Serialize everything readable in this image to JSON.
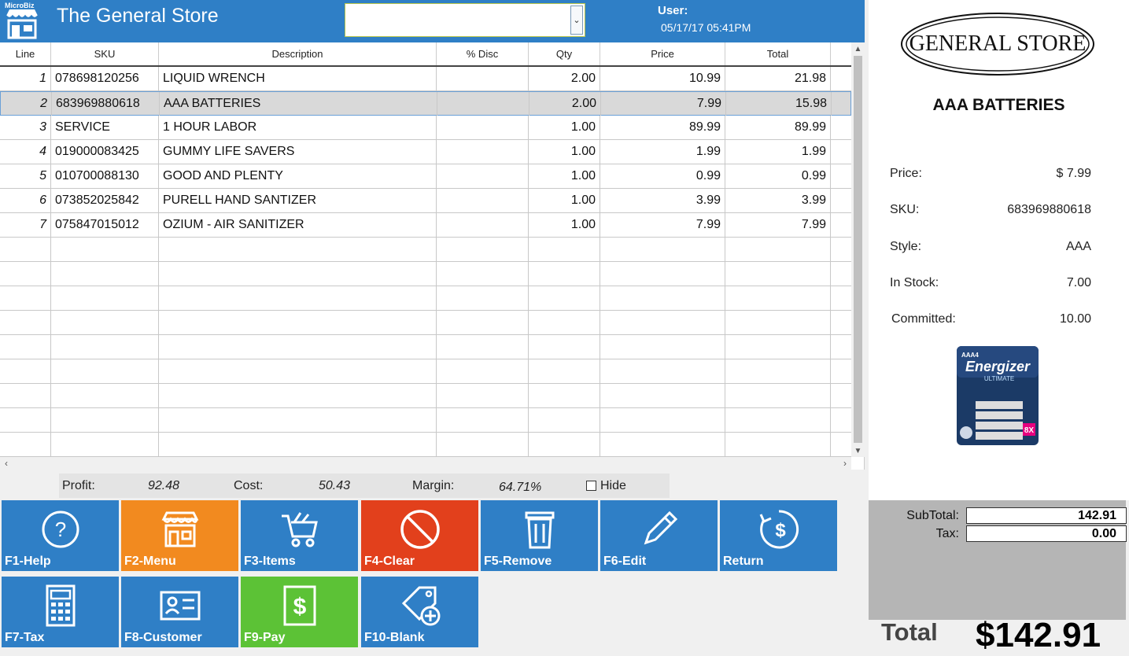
{
  "header": {
    "brand_tag": "MicroBiz",
    "store_title": "The General Store",
    "user_select_value": "",
    "user_label": "User:",
    "datetime": "05/17/17 05:41PM"
  },
  "grid": {
    "columns": [
      "Line",
      "SKU",
      "Description",
      "% Disc",
      "Qty",
      "Price",
      "Total"
    ],
    "rows": [
      {
        "line": "1",
        "sku": "078698120256",
        "description": "LIQUID WRENCH",
        "disc": "",
        "qty": "2.00",
        "price": "10.99",
        "total": "21.98"
      },
      {
        "line": "2",
        "sku": "683969880618",
        "description": "AAA BATTERIES",
        "disc": "",
        "qty": "2.00",
        "price": "7.99",
        "total": "15.98"
      },
      {
        "line": "3",
        "sku": "SERVICE",
        "description": "1 HOUR LABOR",
        "disc": "",
        "qty": "1.00",
        "price": "89.99",
        "total": "89.99"
      },
      {
        "line": "4",
        "sku": "019000083425",
        "description": "GUMMY LIFE SAVERS",
        "disc": "",
        "qty": "1.00",
        "price": "1.99",
        "total": "1.99"
      },
      {
        "line": "5",
        "sku": "010700088130",
        "description": "GOOD AND PLENTY",
        "disc": "",
        "qty": "1.00",
        "price": "0.99",
        "total": "0.99"
      },
      {
        "line": "6",
        "sku": "073852025842",
        "description": "PURELL HAND SANTIZER",
        "disc": "",
        "qty": "1.00",
        "price": "3.99",
        "total": "3.99"
      },
      {
        "line": "7",
        "sku": "075847015012",
        "description": "OZIUM - AIR SANITIZER",
        "disc": "",
        "qty": "1.00",
        "price": "7.99",
        "total": "7.99"
      }
    ],
    "selected_line": "2",
    "empty_rows": 9
  },
  "stats": {
    "profit_label": "Profit:",
    "profit_value": "92.48",
    "cost_label": "Cost:",
    "cost_value": "50.43",
    "margin_label": "Margin:",
    "margin_value": "64.71%",
    "hide_label": "Hide",
    "hide_checked": false
  },
  "buttons": [
    {
      "label": "F1-Help",
      "icon": "help-circle-icon",
      "color": "#2f7fc6"
    },
    {
      "label": "F2-Menu",
      "icon": "storefront-icon",
      "color": "#f28a1f"
    },
    {
      "label": "F3-Items",
      "icon": "shopping-cart-icon",
      "color": "#2f7fc6"
    },
    {
      "label": "F4-Clear",
      "icon": "prohibited-icon",
      "color": "#e2401c"
    },
    {
      "label": "F5-Remove",
      "icon": "trash-icon",
      "color": "#2f7fc6"
    },
    {
      "label": "F6-Edit",
      "icon": "pencil-icon",
      "color": "#2f7fc6"
    },
    {
      "label": "Return",
      "icon": "dollar-refresh-icon",
      "color": "#2f7fc6"
    },
    {
      "label": "F7-Tax",
      "icon": "calculator-icon",
      "color": "#2f7fc6"
    },
    {
      "label": "F8-Customer",
      "icon": "id-card-icon",
      "color": "#2f7fc6"
    },
    {
      "label": "F9-Pay",
      "icon": "dollar-document-icon",
      "color": "#5cc236"
    },
    {
      "label": "F10-Blank",
      "icon": "tag-add-icon",
      "color": "#2f7fc6"
    }
  ],
  "detail": {
    "logo_text": "GENERAL STORE",
    "item_name": "AAA BATTERIES",
    "fields": [
      {
        "label": "Price:",
        "value": "$ 7.99"
      },
      {
        "label": "SKU:",
        "value": "683969880618"
      },
      {
        "label": "Style:",
        "value": "AAA"
      },
      {
        "label": "In Stock:",
        "value": "7.00"
      },
      {
        "label": "Committed:",
        "value": "10.00"
      }
    ],
    "product_image": {
      "brand": "Energizer",
      "line": "ULTIMATE",
      "size": "AAA4",
      "badge": "8X"
    }
  },
  "totals": {
    "subtotal_label": "SubTotal:",
    "subtotal_value": "142.91",
    "tax_label": "Tax:",
    "tax_value": "0.00",
    "total_label": "Total",
    "total_value": "$142.91"
  }
}
